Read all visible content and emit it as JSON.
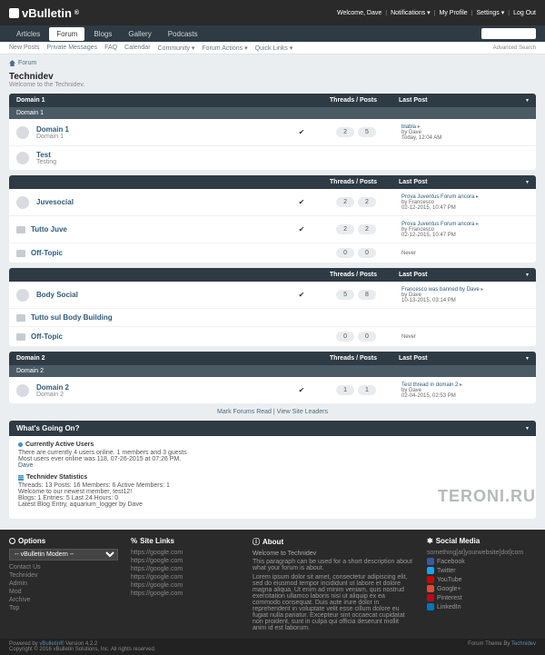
{
  "top": {
    "logo": "vBulletin",
    "welcome": "Welcome, Dave",
    "notifications": "Notifications",
    "profile": "My Profile",
    "settings": "Settings",
    "logout": "Log Out"
  },
  "tabs": [
    "Articles",
    "Forum",
    "Blogs",
    "Gallery",
    "Podcasts"
  ],
  "sub": [
    "New Posts",
    "Private Messages",
    "FAQ",
    "Calendar",
    "Community ▾",
    "Forum Actions ▾",
    "Quick Links ▾"
  ],
  "adv": "Advanced Search",
  "bc": "Forum",
  "page": {
    "title": "Technidev",
    "sub": "Welcome to the Technidev."
  },
  "cols": {
    "tp": "Threads / Posts",
    "lp": "Last Post"
  },
  "blocks": [
    {
      "title": "Domain 1",
      "sub": "Domain 1",
      "rows": [
        {
          "t": "folder",
          "title": "Domain 1",
          "desc": "Domain 1",
          "chk": true,
          "c1": "2",
          "c2": "5",
          "lp": {
            "t": "blabla",
            "by": "by Dave",
            "d": "Today, 12:04 AM"
          }
        },
        {
          "t": "folder",
          "title": "Test",
          "desc": "Testing"
        }
      ]
    },
    {
      "title": "",
      "rows": [
        {
          "t": "folder",
          "title": "Juvesocial",
          "chk": true,
          "c1": "2",
          "c2": "2",
          "lp": {
            "t": "Prova Juventus Forum ancora",
            "by": "by Francesco",
            "d": "02-12-2015, 10:47 PM"
          }
        },
        {
          "t": "sub",
          "title": "Tutto Juve",
          "chk": true,
          "c1": "2",
          "c2": "2",
          "lp": {
            "t": "Prova Juventus Forum ancora",
            "by": "by Francesco",
            "d": "02-12-2015, 10:47 PM"
          }
        },
        {
          "t": "sub",
          "title": "Off-Topic",
          "c1": "0",
          "c2": "0",
          "lp": {
            "never": "Never"
          }
        }
      ]
    },
    {
      "title": "",
      "rows": [
        {
          "t": "folder",
          "title": "Body Social",
          "chk": true,
          "c1": "5",
          "c2": "8",
          "lp": {
            "t": "Francesco was banned by Dave",
            "by": "by Dave",
            "d": "10-13-2015, 03:14 PM"
          }
        },
        {
          "t": "sub2",
          "title": "Tutto sul Body Building"
        },
        {
          "t": "sub",
          "title": "Off-Topic",
          "c1": "0",
          "c2": "0",
          "lp": {
            "never": "Never"
          }
        }
      ]
    },
    {
      "title": "Domain 2",
      "sub": "Domain 2",
      "rows": [
        {
          "t": "folder",
          "title": "Domain 2",
          "desc": "Domain 2",
          "chk": true,
          "c1": "1",
          "c2": "1",
          "lp": {
            "t": "Test thread in domain 2",
            "by": "by Dave",
            "d": "02-04-2015, 02:53 PM"
          }
        }
      ]
    }
  ],
  "mid": {
    "a": "Mark Forums Read",
    "b": "View Site Leaders"
  },
  "wgo": {
    "title": "What's Going On?",
    "active": {
      "h": "Currently Active Users",
      "l1": "There are currently 4 users online. 1 members and 3 guests",
      "l2": "Most users ever online was 118, 07-26-2015 at 07:26 PM.",
      "l3": "Dave"
    },
    "stats": {
      "h": "Technidev Statistics",
      "l1": "Threads: 13   Posts: 16   Members: 6   Active Members: 1",
      "l2": "Welcome to our newest member, test12!",
      "l3": "Blogs: 1   Entries: 5   Last 24 Hours: 0",
      "l4": "Latest Blog Entry, aquarium_logger by Dave"
    }
  },
  "footer": {
    "opt": {
      "h": "Options",
      "sel": "-- vBulletin Modern --",
      "links": [
        "Contact Us",
        "Technidev",
        "Admin",
        "Mod",
        "Archive",
        "Top"
      ]
    },
    "site": {
      "h": "Site Links",
      "links": [
        "https://google.com",
        "https://google.com",
        "https://google.com",
        "https://google.com",
        "https://google.com",
        "https://google.com"
      ]
    },
    "about": {
      "h": "About",
      "t": "Welcome to Technidev",
      "p1": "This paragraph can be used for a short description about what your forum is about.",
      "p2": "Lorem ipsum dolor sit amet, consectetur adipiscing elit, sed do eiusmod tempor incididunt ut labore et dolore magna aliqua. Ut enim ad minim veniam, quis nostrud exercitation ullamco laboris nisi ut aliquip ex ea commodo consequat. Duis aute irure dolor in reprehenderit in voluptate velit esse cillum dolore eu fugiat nulla pariatur. Excepteur sint occaecat cupidatat non proident, sunt in culpa qui officia deserunt mollit anim id est laborum."
    },
    "soc": {
      "h": "Social Media",
      "email": "something[at]yourwebsite[dot]com",
      "items": [
        "Facebook",
        "Twitter",
        "YouTube",
        "Google+",
        "Pinterest",
        "LinkedIn"
      ]
    }
  },
  "copy": {
    "l1": "Powered by vBulletin® Version 4.2.2",
    "l2": "Copyright © 2016 vBulletin Solutions, Inc. All rights reserved.",
    "r": "Forum Theme By Technidev"
  },
  "wm": "TERONI.RU"
}
